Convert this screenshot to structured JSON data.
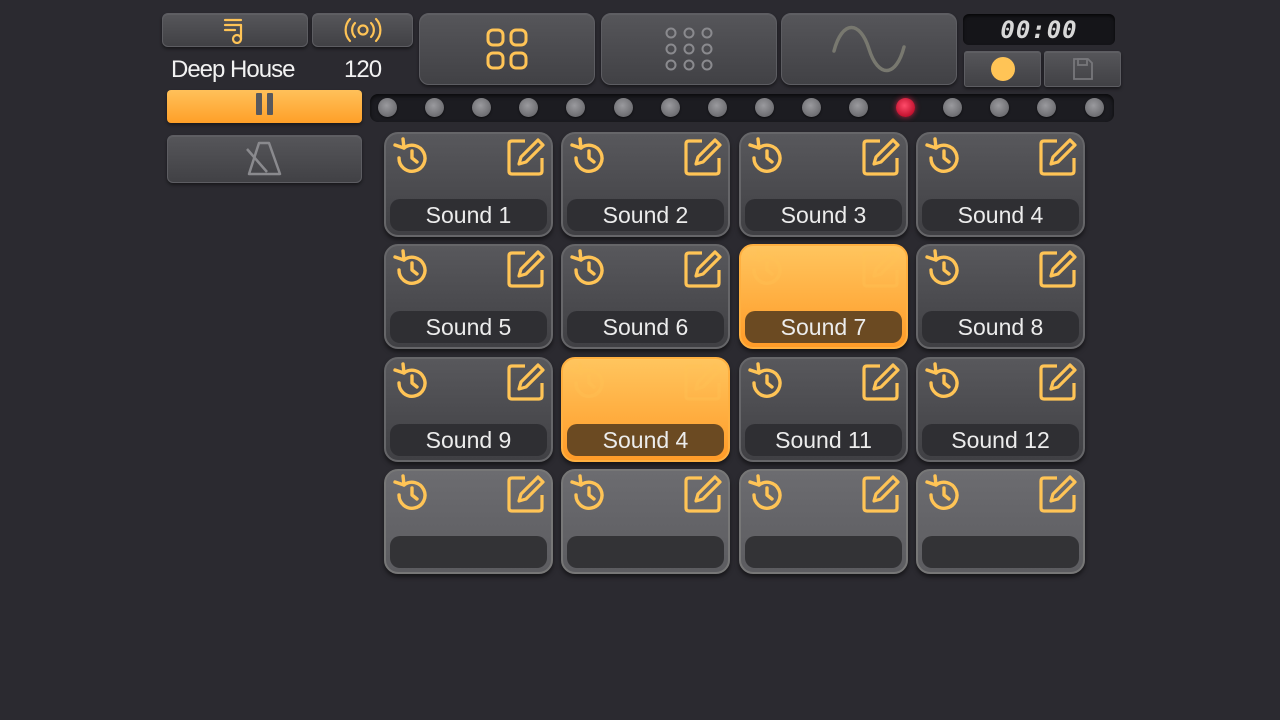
{
  "header": {
    "style_name": "Deep House",
    "tempo": "120",
    "timer": "00:00"
  },
  "icons": {
    "playlist": "playlist-music-icon",
    "broadcast": "broadcast-icon",
    "pad_grid": "pad-grid-icon",
    "dot_grid": "dot-grid-icon",
    "wave": "sine-wave-icon",
    "record": "record-dot-icon",
    "save": "save-disk-icon",
    "pause": "pause-icon",
    "metronome": "metronome-icon",
    "loop": "loop-icon",
    "edit": "edit-icon"
  },
  "colors": {
    "accent": "#ffb040",
    "step_active": "#e0203f",
    "background": "#2b2a30"
  },
  "sequencer": {
    "step_count": 16,
    "active_step": 12
  },
  "pads": [
    {
      "label": "Sound 1",
      "state": "normal"
    },
    {
      "label": "Sound 2",
      "state": "normal"
    },
    {
      "label": "Sound 3",
      "state": "normal"
    },
    {
      "label": "Sound 4",
      "state": "normal"
    },
    {
      "label": "Sound 5",
      "state": "normal"
    },
    {
      "label": "Sound 6",
      "state": "normal"
    },
    {
      "label": "Sound 7",
      "state": "active"
    },
    {
      "label": "Sound 8",
      "state": "normal"
    },
    {
      "label": "Sound 9",
      "state": "normal"
    },
    {
      "label": "Sound 4",
      "state": "active"
    },
    {
      "label": "Sound 11",
      "state": "normal"
    },
    {
      "label": "Sound 12",
      "state": "normal"
    },
    {
      "label": "",
      "state": "empty"
    },
    {
      "label": "",
      "state": "empty"
    },
    {
      "label": "",
      "state": "empty"
    },
    {
      "label": "",
      "state": "empty"
    }
  ]
}
